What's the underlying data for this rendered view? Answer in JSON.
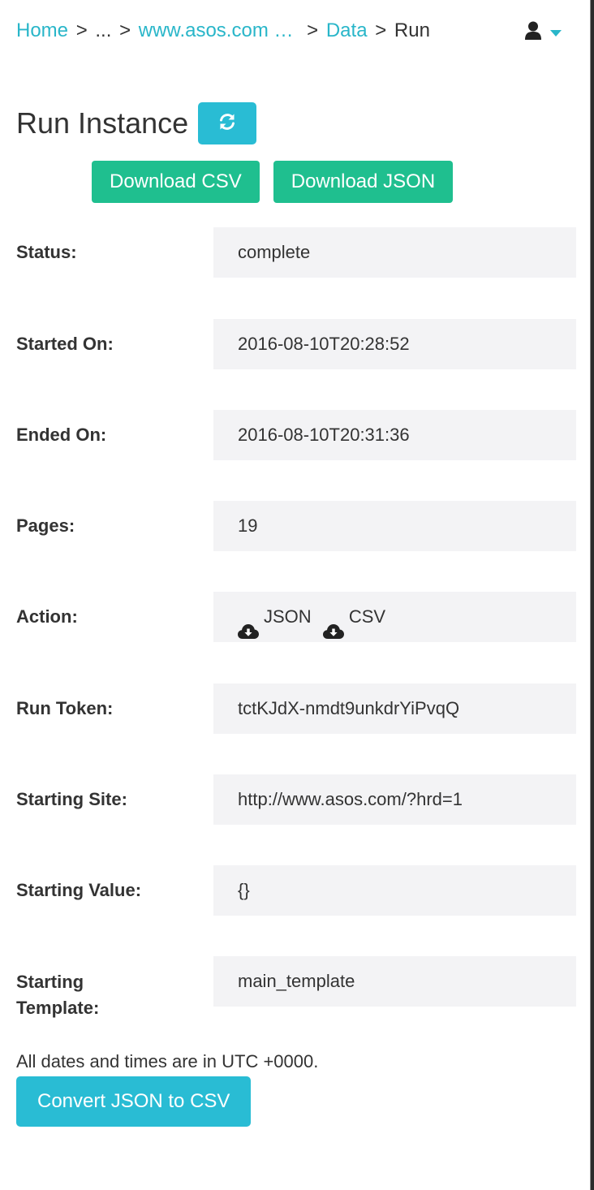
{
  "breadcrumb": {
    "home": "Home",
    "sep": ">",
    "ellipsis": "...",
    "site": "www.asos.com …",
    "data": "Data",
    "current": "Run"
  },
  "header": {
    "user_icon": "user-icon",
    "caret_icon": "caret-down-icon",
    "accent": "#29b6c9"
  },
  "page": {
    "title": "Run Instance",
    "refresh_icon": "refresh-icon"
  },
  "downloads": {
    "csv_label": "Download CSV",
    "json_label": "Download JSON",
    "color": "#1fbf8f"
  },
  "fields": {
    "status": {
      "label": "Status:",
      "value": "complete"
    },
    "started_on": {
      "label": "Started On:",
      "value": "2016-08-10T20:28:52"
    },
    "ended_on": {
      "label": "Ended On:",
      "value": "2016-08-10T20:31:36"
    },
    "pages": {
      "label": "Pages:",
      "value": "19"
    },
    "action": {
      "label": "Action:",
      "json": "JSON",
      "csv": "CSV",
      "icon": "cloud-download-icon"
    },
    "run_token": {
      "label": "Run Token:",
      "value": "tctKJdX-nmdt9unkdrYiPvqQ"
    },
    "starting_site": {
      "label": "Starting Site:",
      "value": "http://www.asos.com/?hrd=1"
    },
    "starting_value": {
      "label": "Starting Value:",
      "value": "{}"
    },
    "starting_template": {
      "label_line1": "Starting",
      "label_line2": "Template:",
      "value": "main_template"
    }
  },
  "footer": {
    "note": "All dates and times are in UTC +0000.",
    "convert_label": "Convert JSON to CSV",
    "button_color": "#29bcd4"
  }
}
